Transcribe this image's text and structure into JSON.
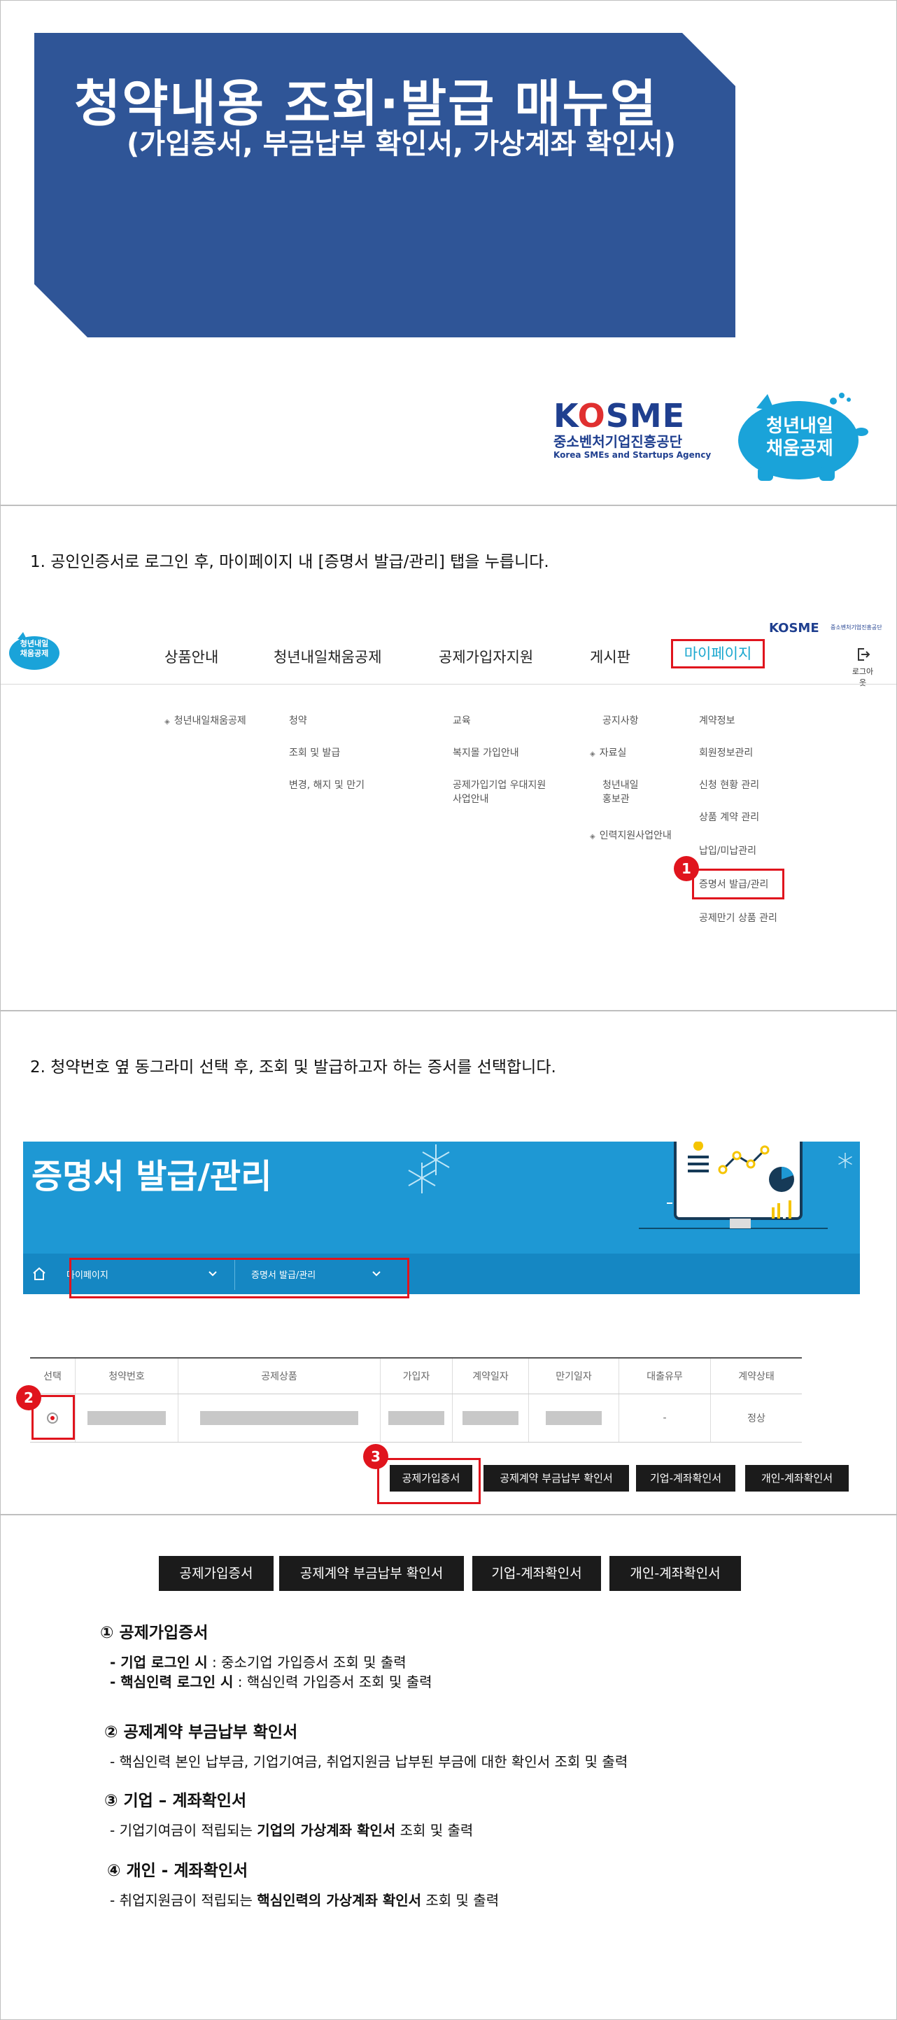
{
  "slide1": {
    "title": "청약내용 조회·발급 매뉴얼",
    "subtitle": "(가입증서, 부금납부 확인서, 가상계좌 확인서)",
    "logo": {
      "word_k": "K",
      "word_o": "O",
      "word_rest": "SME",
      "korean": "중소벤처기업진흥공단",
      "english": "Korea SMEs and Startups Agency"
    },
    "pig_logo": {
      "line1": "청년내일",
      "line2": "채움공제"
    }
  },
  "slide2": {
    "instruction": "1. 공인인증서로 로그인 후, 마이페이지 내 [증명서 발급/관리] 탭을 누릅니다.",
    "site_logo": {
      "line1": "청년내일",
      "line2": "채움공제"
    },
    "kosme": "KOSME",
    "kosme_sub": "중소벤처기업진흥공단",
    "nav": [
      "상품안내",
      "청년내일채움공제",
      "공제가입자지원",
      "게시판"
    ],
    "nav_mypage": "마이페이지",
    "logout": "로그아웃",
    "menu": {
      "col1": [
        "청년내일채움공제"
      ],
      "col2": [
        "청약",
        "조회 및 발급",
        "변경, 해지 및 만기"
      ],
      "col3": [
        "교육",
        "복지몰 가입안내",
        "공제가입기업 우대지원",
        "사업안내"
      ],
      "col4": [
        "공지사항",
        "자료실",
        "청년내일",
        "홍보관",
        "인력지원사업안내"
      ],
      "col5": [
        "계약정보",
        "회원정보관리",
        "신청 현황 관리",
        "상품 계약 관리",
        "납입/미납관리",
        "증명서 발급/관리",
        "공제만기 상품 관리"
      ]
    },
    "marker": "1"
  },
  "slide3": {
    "instruction": "2. 청약번호 옆 동그라미 선택 후, 조회 및 발급하고자 하는 증서를 선택합니다.",
    "banner_title": "증명서 발급/관리",
    "crumb1": "마이페이지",
    "crumb2": "증명서 발급/관리",
    "table": {
      "headers": [
        "선택",
        "청약번호",
        "공제상품",
        "가입자",
        "계약일자",
        "만기일자",
        "대출유무",
        "계약상태"
      ],
      "row": {
        "loan": "-",
        "status": "정상"
      }
    },
    "buttons": [
      "공제가입증서",
      "공제계약 부금납부 확인서",
      "기업-계좌확인서",
      "개인-계좌확인서"
    ],
    "marker2": "2",
    "marker3": "3"
  },
  "slide4": {
    "buttons": [
      "공제가입증서",
      "공제계약 부금납부 확인서",
      "기업-계좌확인서",
      "개인-계좌확인서"
    ],
    "s1": {
      "title": "① 공제가입증서",
      "l1_bold": "- 기업 로그인 시",
      "l1_rest": " : 중소기업 가입증서 조회 및 출력",
      "l2_bold": "- 핵심인력 로그인 시",
      "l2_rest": " : 핵심인력 가입증서 조회 및 출력"
    },
    "s2": {
      "title": "② 공제계약 부금납부 확인서",
      "l1": "-  핵심인력 본인 납부금, 기업기여금, 취업지원금 납부된 부금에 대한 확인서 조회 및 출력"
    },
    "s3": {
      "title": "③ 기업 – 계좌확인서",
      "l1_a": "- 기업기여금이 적립되는 ",
      "l1_b": "기업의 가상계좌 확인서",
      "l1_c": " 조회 및 출력"
    },
    "s4": {
      "title": "④ 개인  - 계좌확인서",
      "l1_a": "- 취업지원금이 적립되는 ",
      "l1_b": "핵심인력의 가상계좌 확인서",
      "l1_c": " 조회 및 출력"
    }
  }
}
